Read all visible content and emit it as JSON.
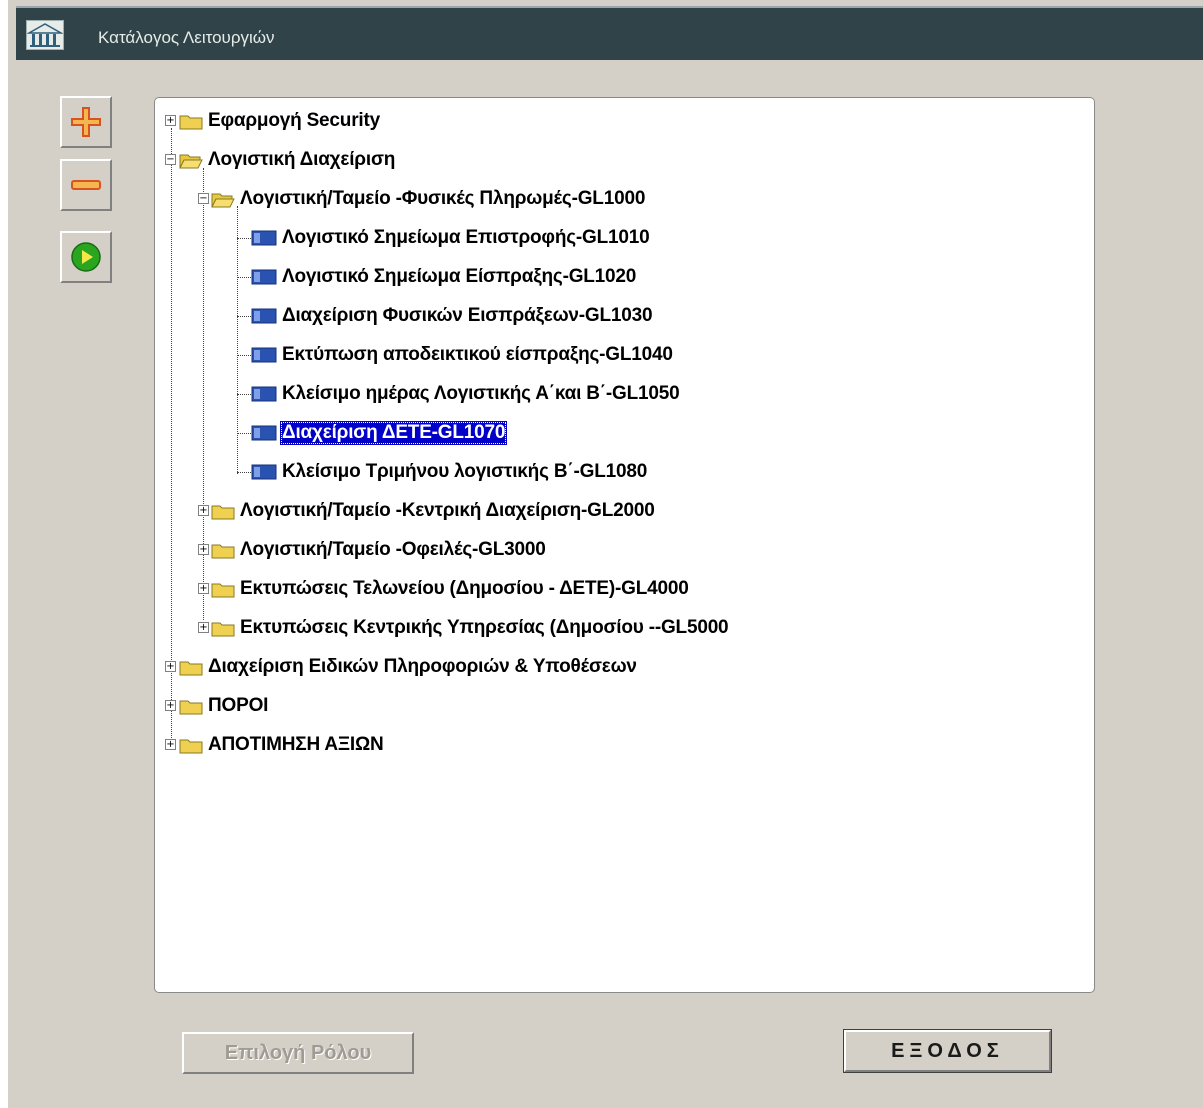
{
  "window": {
    "title": "Κατάλογος Λειτουργιών"
  },
  "toolbar": {
    "expand_icon": "plus-icon",
    "collapse_icon": "minus-icon",
    "run_icon": "play-icon"
  },
  "tree": {
    "nodes": [
      {
        "label": "Εφαρμογή Security",
        "type": "folder",
        "level": 0,
        "expanded": false
      },
      {
        "label": "Λογιστική Διαχείριση",
        "type": "folder",
        "level": 0,
        "expanded": true
      },
      {
        "label": "Λογιστική/Ταμείο -Φυσικές Πληρωμές-GL1000",
        "type": "folder",
        "level": 1,
        "expanded": true
      },
      {
        "label": "Λογιστικό Σημείωμα Επιστροφής-GL1010",
        "type": "leaf",
        "level": 2
      },
      {
        "label": "Λογιστικό Σημείωμα Είσπραξης-GL1020",
        "type": "leaf",
        "level": 2
      },
      {
        "label": "Διαχείριση Φυσικών Εισπράξεων-GL1030",
        "type": "leaf",
        "level": 2
      },
      {
        "label": "Εκτύπωση αποδεικτικού είσπραξης-GL1040",
        "type": "leaf",
        "level": 2
      },
      {
        "label": "Κλείσιμο ημέρας Λογιστικής Α΄και Β΄-GL1050",
        "type": "leaf",
        "level": 2
      },
      {
        "label": "Διαχείριση ΔΕΤΕ-GL1070",
        "type": "leaf",
        "level": 2,
        "selected": true
      },
      {
        "label": "Κλείσιμο Τριμήνου λογιστικής Β΄-GL1080",
        "type": "leaf",
        "level": 2
      },
      {
        "label": "Λογιστική/Ταμείο -Κεντρική Διαχείριση-GL2000",
        "type": "folder",
        "level": 1,
        "expanded": false
      },
      {
        "label": "Λογιστική/Ταμείο -Οφειλές-GL3000",
        "type": "folder",
        "level": 1,
        "expanded": false
      },
      {
        "label": "Εκτυπώσεις  Τελωνείου (Δημοσίου - ΔΕΤΕ)-GL4000",
        "type": "folder",
        "level": 1,
        "expanded": false
      },
      {
        "label": "Εκτυπώσεις  Κεντρικής Υπηρεσίας (Δημοσίου --GL5000",
        "type": "folder",
        "level": 1,
        "expanded": false
      },
      {
        "label": "Διαχείριση Ειδικών Πληροφοριών & Υποθέσεων",
        "type": "folder",
        "level": 0,
        "expanded": false
      },
      {
        "label": "ΠΟΡΟΙ",
        "type": "folder",
        "level": 0,
        "expanded": false
      },
      {
        "label": "ΑΠΟΤΙΜΗΣΗ ΑΞΙΩΝ",
        "type": "folder",
        "level": 0,
        "expanded": false
      }
    ]
  },
  "buttons": {
    "role_select": "Επιλογή Ρόλου",
    "exit": "ΕΞΟΔΟΣ"
  },
  "colors": {
    "titlebar": "#2f4349",
    "selection": "#0000c8",
    "folder": "#f0d050",
    "leaf": "#2a52b0"
  }
}
